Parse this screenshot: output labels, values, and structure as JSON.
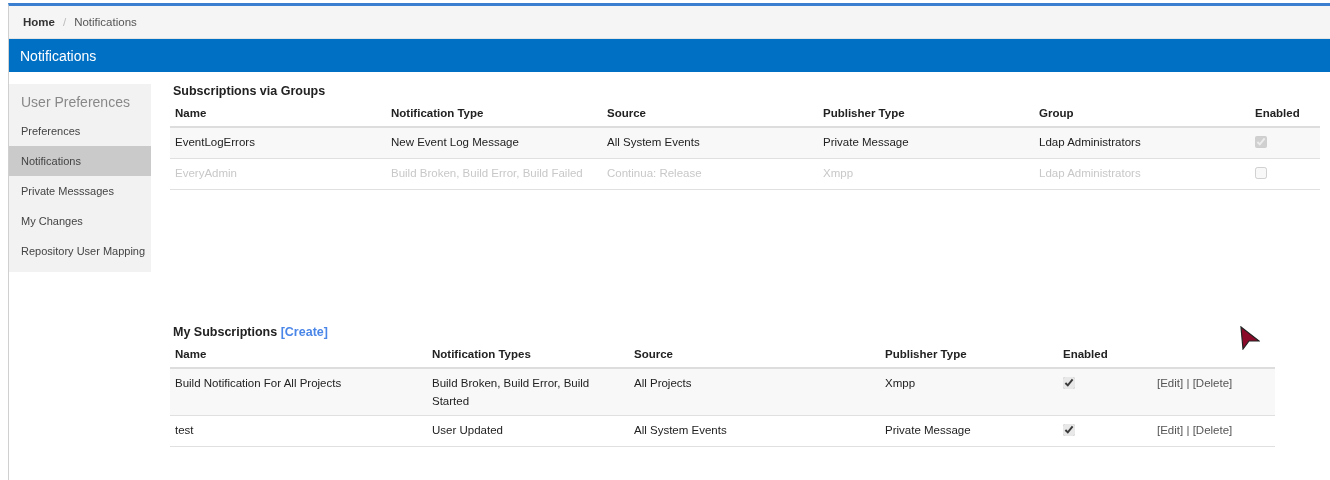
{
  "breadcrumb": [
    {
      "label": "Home",
      "current": false
    },
    {
      "label": "Notifications",
      "current": true
    }
  ],
  "breadcrumb_separator": "/",
  "header": {
    "title": "Notifications"
  },
  "sidebar": {
    "title": "User Preferences",
    "items": [
      {
        "label": "Preferences",
        "selected": false
      },
      {
        "label": "Notifications",
        "selected": true
      },
      {
        "label": "Private Messsages",
        "selected": false
      },
      {
        "label": "My Changes",
        "selected": false
      },
      {
        "label": "Repository User Mapping",
        "selected": false
      }
    ]
  },
  "group_subscriptions": {
    "title": "Subscriptions via Groups",
    "columns": [
      "Name",
      "Notification Type",
      "Source",
      "Publisher Type",
      "Group",
      "Enabled"
    ],
    "rows": [
      {
        "name": "EventLogErrors",
        "notification_type": "New Event Log Message",
        "source": "All System Events",
        "publisher_type": "Private Message",
        "group": "Ldap Administrators",
        "enabled": true,
        "active": true
      },
      {
        "name": "EveryAdmin",
        "notification_type": "Build Broken, Build Error, Build Failed",
        "source": "Continua: Release",
        "publisher_type": "Xmpp",
        "group": "Ldap Administrators",
        "enabled": false,
        "active": false
      }
    ]
  },
  "my_subscriptions": {
    "title": "My Subscriptions",
    "create_link": "[Create]",
    "columns": [
      "Name",
      "Notification Types",
      "Source",
      "Publisher Type",
      "Enabled"
    ],
    "rows": [
      {
        "name": "Build Notification For All Projects",
        "notification_types": "Build Broken, Build Error, Build Started",
        "source": "All Projects",
        "publisher_type": "Xmpp",
        "enabled": true,
        "edit": "[Edit]",
        "separator": "|",
        "delete": "[Delete]"
      },
      {
        "name": "test",
        "notification_types": "User Updated",
        "source": "All System Events",
        "publisher_type": "Private Message",
        "enabled": true,
        "edit": "[Edit]",
        "separator": "|",
        "delete": "[Delete]"
      }
    ]
  }
}
